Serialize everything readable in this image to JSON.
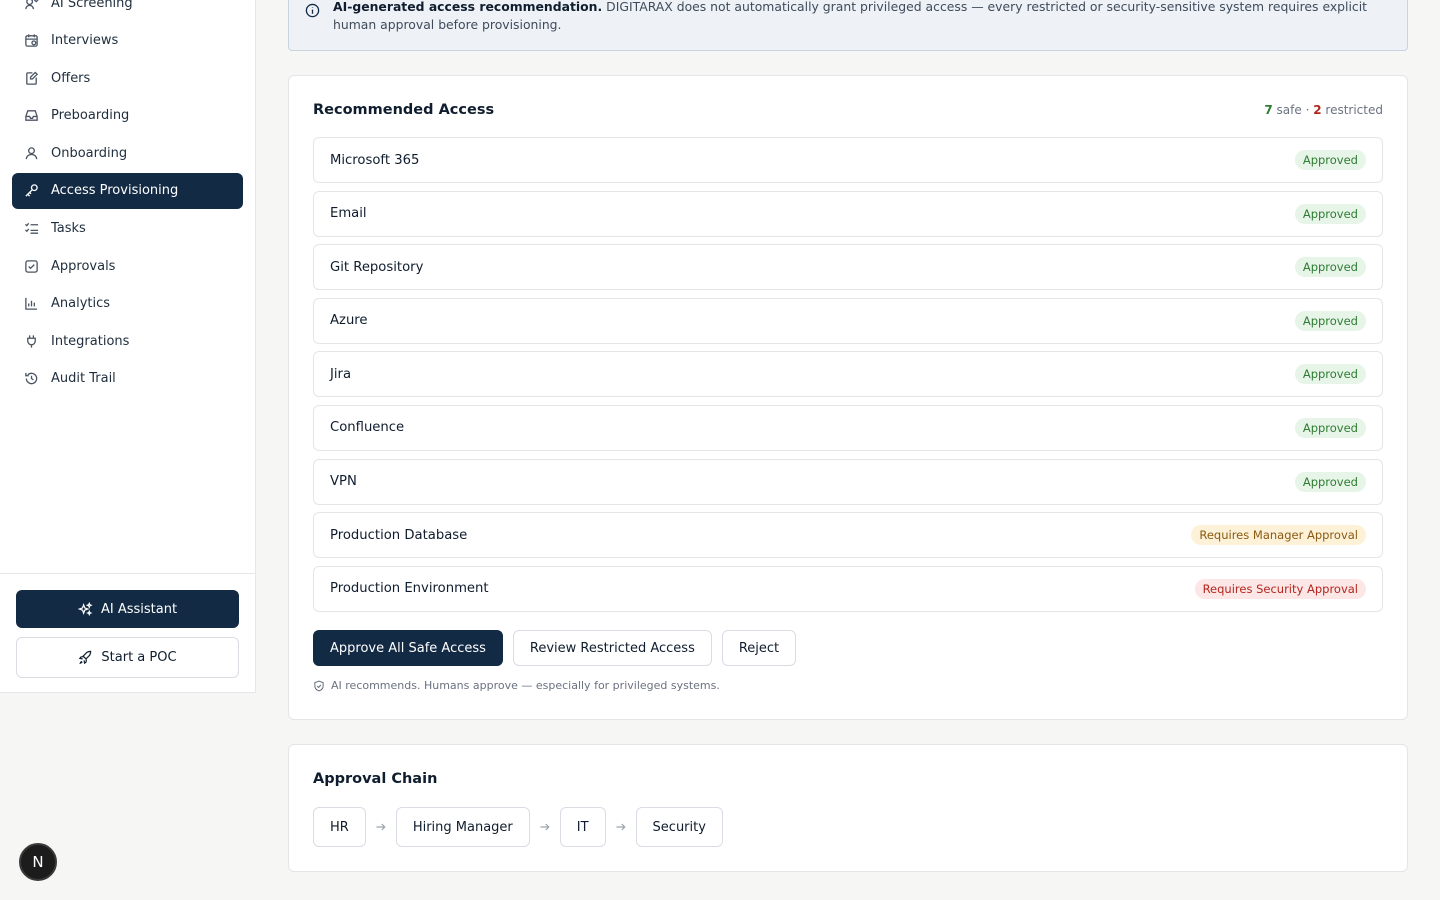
{
  "sidebar": {
    "items": [
      {
        "label": "AI Screening",
        "icon": "screening-icon"
      },
      {
        "label": "Interviews",
        "icon": "calendar-icon"
      },
      {
        "label": "Offers",
        "icon": "document-edit-icon"
      },
      {
        "label": "Preboarding",
        "icon": "inbox-icon"
      },
      {
        "label": "Onboarding",
        "icon": "user-icon"
      },
      {
        "label": "Access Provisioning",
        "icon": "key-icon",
        "active": true
      },
      {
        "label": "Tasks",
        "icon": "checklist-icon"
      },
      {
        "label": "Approvals",
        "icon": "check-square-icon"
      },
      {
        "label": "Analytics",
        "icon": "bar-chart-icon"
      },
      {
        "label": "Integrations",
        "icon": "plug-icon"
      },
      {
        "label": "Audit Trail",
        "icon": "history-icon"
      }
    ],
    "ai_assistant_label": "AI Assistant",
    "start_poc_label": "Start a POC"
  },
  "avatar": {
    "initial": "N"
  },
  "notice": {
    "bold": "AI-generated access recommendation.",
    "text": "DIGITARAX does not automatically grant privileged access — every restricted or security-sensitive system requires explicit human approval before provisioning."
  },
  "access": {
    "title": "Recommended Access",
    "safe_count": "7",
    "safe_label": "safe",
    "separator": "·",
    "restricted_count": "2",
    "restricted_label": "restricted",
    "rows": [
      {
        "name": "Microsoft 365",
        "status": "Approved",
        "kind": "approved"
      },
      {
        "name": "Email",
        "status": "Approved",
        "kind": "approved"
      },
      {
        "name": "Git Repository",
        "status": "Approved",
        "kind": "approved"
      },
      {
        "name": "Azure",
        "status": "Approved",
        "kind": "approved"
      },
      {
        "name": "Jira",
        "status": "Approved",
        "kind": "approved"
      },
      {
        "name": "Confluence",
        "status": "Approved",
        "kind": "approved"
      },
      {
        "name": "VPN",
        "status": "Approved",
        "kind": "approved"
      },
      {
        "name": "Production Database",
        "status": "Requires Manager Approval",
        "kind": "manager"
      },
      {
        "name": "Production Environment",
        "status": "Requires Security Approval",
        "kind": "security"
      }
    ],
    "approve_all_label": "Approve All Safe Access",
    "review_label": "Review Restricted Access",
    "reject_label": "Reject",
    "footnote": "AI recommends. Humans approve — especially for privileged systems."
  },
  "chain": {
    "title": "Approval Chain",
    "steps": [
      "HR",
      "Hiring Manager",
      "IT",
      "Security"
    ]
  },
  "colors": {
    "primary": "#132a45",
    "approved": "#2e7d32",
    "manager": "#8a5a12",
    "security": "#b3261e"
  }
}
